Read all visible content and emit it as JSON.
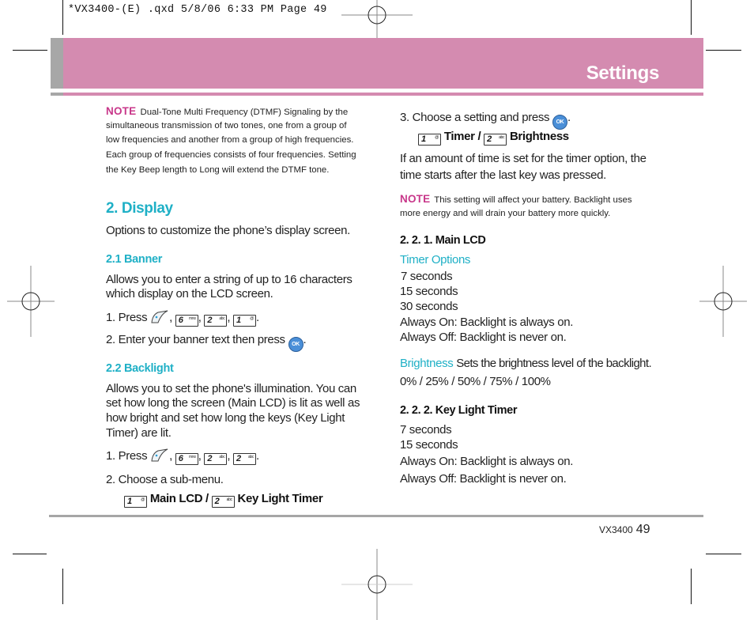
{
  "slug": "*VX3400-(E) .qxd  5/8/06  6:33 PM  Page 49",
  "header": {
    "title": "Settings",
    "band_color": "#d48bb0",
    "accent_color": "#1fb0c6",
    "note_color": "#c8378a"
  },
  "left": {
    "note": {
      "label": "NOTE",
      "lines": [
        "Dual-Tone Multi Frequency (DTMF) Signaling by the",
        "simultaneous transmission of two tones, one from a group of",
        "low frequencies and another from a group of high frequencies.",
        "Each group of frequencies consists of four frequencies. Setting",
        "the Key Beep length to Long will extend the DTMF tone."
      ]
    },
    "display": {
      "heading": "2. Display",
      "desc": "Options to customize the phone’s display screen."
    },
    "banner": {
      "heading": "2.1 Banner",
      "lines": [
        "Allows you to enter a string of up to 16 characters",
        "which display on the LCD screen."
      ],
      "step1": "1.  Press",
      "step1_keys": [
        "6",
        "2",
        "1"
      ],
      "step1_key_subs": [
        "mno",
        "abc",
        "@"
      ],
      "step2": "2.  Enter your banner text then press",
      "ok": "OK"
    },
    "backlight": {
      "heading": "2.2 Backlight",
      "lines": [
        "Allows you to set the phone's illumination. You can",
        "set how long the screen (Main LCD) is lit as well as",
        "how bright and set how long the keys (Key Light",
        "Timer) are lit."
      ],
      "step1": "1.  Press",
      "step1_keys": [
        "6",
        "2",
        "2"
      ],
      "step1_key_subs": [
        "mno",
        "abc",
        "abc"
      ],
      "step2": "2.  Choose a sub-menu.",
      "submenu": [
        {
          "key": "1",
          "sub": "@",
          "label": "Main LCD /"
        },
        {
          "key": "2",
          "sub": "abc",
          "label": "Key Light Timer"
        }
      ]
    }
  },
  "right": {
    "step3": "3.  Choose a setting and press",
    "ok": "OK",
    "options": [
      {
        "key": "1",
        "sub": "@",
        "label": "Timer /"
      },
      {
        "key": "2",
        "sub": "abc",
        "label": "Brightness"
      }
    ],
    "timer_desc": [
      "If an amount of time is set for the timer option, the",
      "time starts after the last key was pressed."
    ],
    "note": {
      "label": "NOTE",
      "lines": [
        "This setting will affect your battery. Backlight uses",
        "more energy and will drain your battery more quickly."
      ]
    },
    "main_lcd": {
      "heading": "2. 2. 1. Main LCD",
      "timer_label": "Timer Options",
      "timer_items": [
        "7 seconds",
        "15 seconds",
        "30 seconds",
        "Always On: Backlight is always on.",
        "Always Off: Backlight is never on."
      ],
      "brightness_label": "Brightness",
      "brightness_desc": "Sets the brightness level of the backlight.",
      "brightness_values": "0% / 25% / 50% / 75% / 100%"
    },
    "key_light": {
      "heading": "2. 2. 2. Key Light Timer",
      "items": [
        "7 seconds",
        "15 seconds",
        "Always On: Backlight is always on.",
        "Always Off: Backlight is never on."
      ]
    }
  },
  "footer": {
    "model": "VX3400",
    "page": "49"
  }
}
